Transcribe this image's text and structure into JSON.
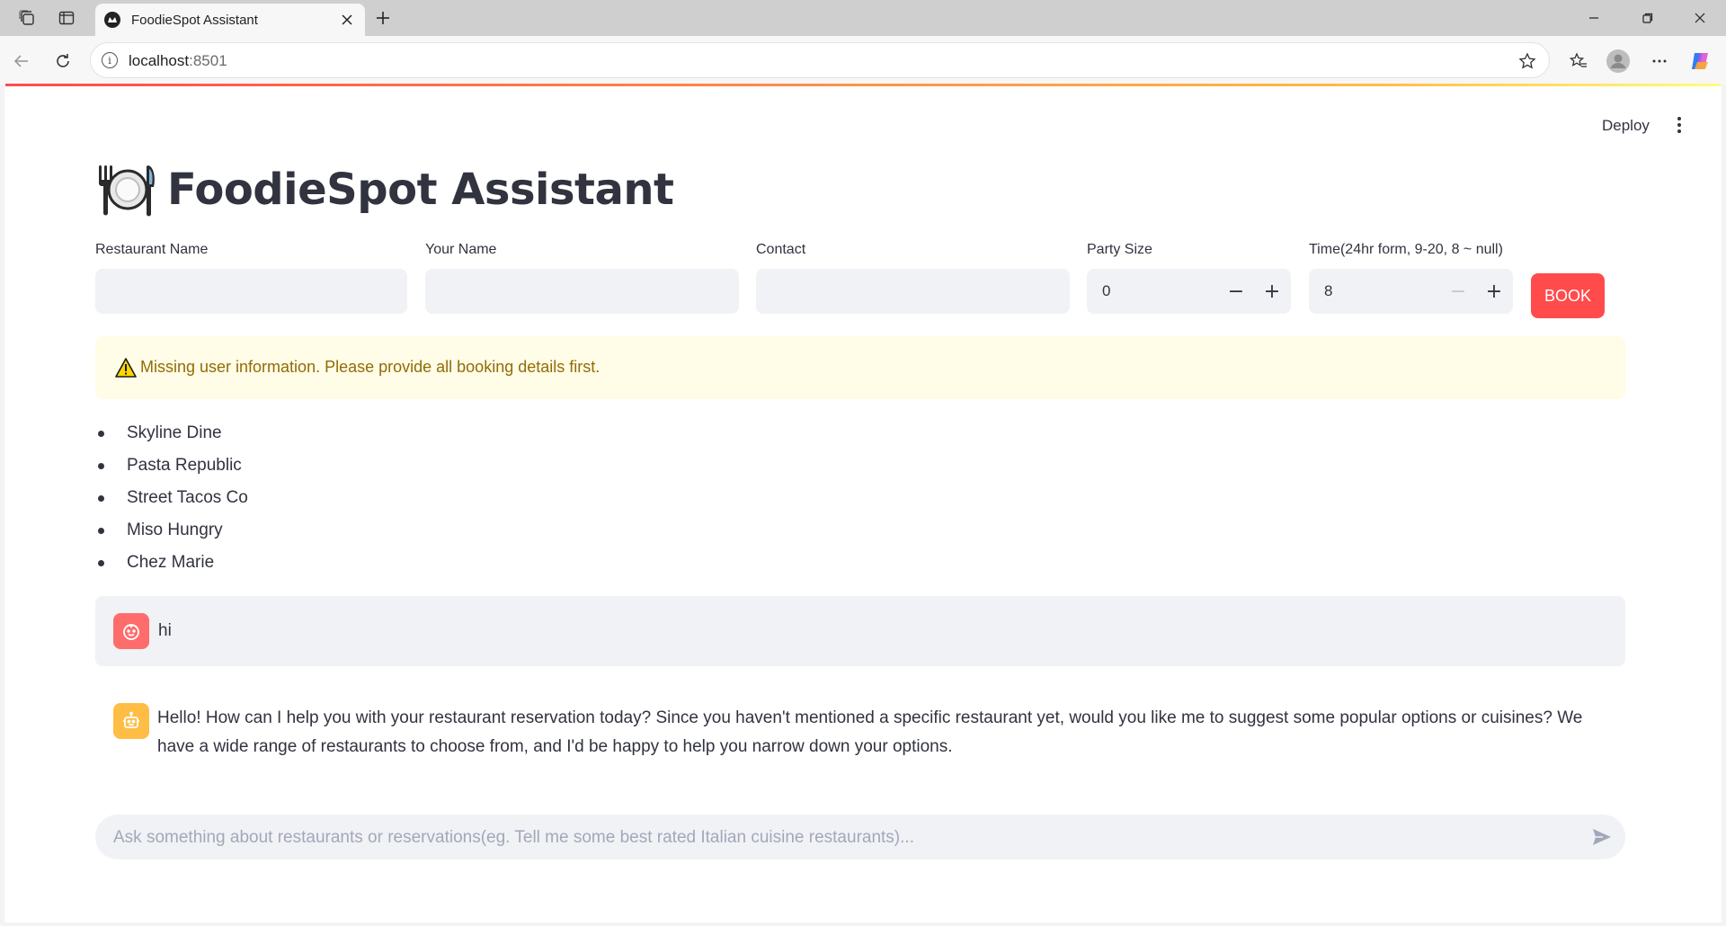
{
  "browser": {
    "tab_title": "FoodieSpot Assistant",
    "url_host": "localhost",
    "url_port": ":8501"
  },
  "app": {
    "deploy_label": "Deploy",
    "title": "FoodieSpot Assistant",
    "title_icon": "plate-with-cutlery-emoji"
  },
  "form": {
    "restaurant_name": {
      "label": "Restaurant Name",
      "value": ""
    },
    "your_name": {
      "label": "Your Name",
      "value": ""
    },
    "contact": {
      "label": "Contact",
      "value": ""
    },
    "party_size": {
      "label": "Party Size",
      "value": "0",
      "minus": "−",
      "plus": "+"
    },
    "time": {
      "label": "Time(24hr form, 9-20, 8 ~ null)",
      "value": "8",
      "minus": "−",
      "plus": "+"
    },
    "book_label": "BOOK"
  },
  "warning": {
    "text": "Missing user information. Please provide all booking details first.",
    "icon": "warning-triangle-icon",
    "color": "#926c05"
  },
  "restaurants": [
    "Skyline Dine",
    "Pasta Republic",
    "Street Tacos Co",
    "Miso Hungry",
    "Chez Marie"
  ],
  "chat": {
    "messages": [
      {
        "role": "user",
        "text": "hi"
      },
      {
        "role": "assistant",
        "text": "Hello! How can I help you with your restaurant reservation today? Since you haven't mentioned a specific restaurant yet, would you like me to suggest some popular options or cuisines? We have a wide range of restaurants to choose from, and I'd be happy to help you narrow down your options."
      }
    ],
    "input_placeholder": "Ask something about restaurants or reservations(eg. Tell me some best rated Italian cuisine restaurants)..."
  },
  "colors": {
    "accent": "#ff4b4b",
    "user_avatar": "#ff6c6c",
    "bot_avatar": "#ffbd45",
    "input_bg": "#f0f2f6",
    "warning_bg": "#fffce7"
  }
}
